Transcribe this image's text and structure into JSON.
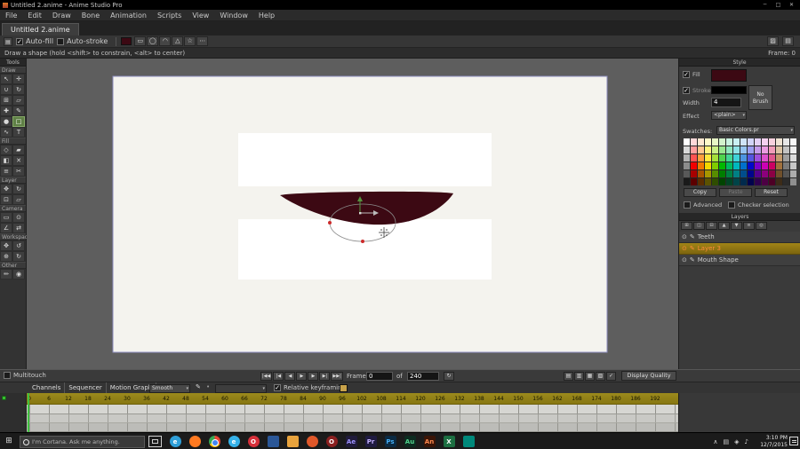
{
  "titlebar": {
    "title": "Untitled 2.anime - Anime Studio Pro",
    "window_buttons": [
      {
        "name": "minimize",
        "glyph": "─"
      },
      {
        "name": "maximize",
        "glyph": "□"
      },
      {
        "name": "close",
        "glyph": "✕"
      }
    ]
  },
  "menubar": {
    "items": [
      "File",
      "Edit",
      "Draw",
      "Bone",
      "Animation",
      "Scripts",
      "View",
      "Window",
      "Help"
    ]
  },
  "tabbar": {
    "active_tab": "Untitled 2.anime"
  },
  "toolbar": {
    "auto_fill_label": "Auto-fill",
    "auto_fill_checked": true,
    "auto_stroke_label": "Auto-stroke",
    "auto_stroke_checked": false,
    "shape_options": [
      {
        "name": "rectangle-option",
        "glyph": "▭"
      },
      {
        "name": "oval-option",
        "glyph": "◯"
      },
      {
        "name": "arc-option",
        "glyph": "◠"
      },
      {
        "name": "triangle-option",
        "glyph": "△"
      },
      {
        "name": "star-option",
        "glyph": "☆"
      },
      {
        "name": "more-options",
        "glyph": "⋯"
      }
    ],
    "right_buttons": [
      {
        "name": "panel-toggle-1",
        "glyph": "▨"
      },
      {
        "name": "panel-toggle-2",
        "glyph": "▤"
      }
    ]
  },
  "hintbar": {
    "hint": "Draw a shape (hold <shift> to constrain, <alt> to center)",
    "frame_indicator": "Frame: 0"
  },
  "tools_panel": {
    "title": "Tools",
    "selected_tool": "draw-shape",
    "sections": [
      {
        "label": "Draw",
        "tools": [
          "select",
          "translate-points",
          "magnet",
          "rotate-points",
          "scale-points",
          "shear",
          "add-point",
          "freehand",
          "blob",
          "draw-shape",
          "curvature",
          "text"
        ]
      },
      {
        "label": "Fill",
        "tools": [
          "select-shape",
          "create-shape",
          "paint-bucket",
          "delete-shape",
          "line-width",
          "hide-edge"
        ]
      },
      {
        "label": "Layer",
        "tools": [
          "translate-layer",
          "rotate-layer",
          "scale-layer",
          "shear-layer"
        ]
      },
      {
        "label": "Camera",
        "tools": [
          "track-camera",
          "zoom-camera",
          "roll-camera",
          "pan-tilt-camera"
        ]
      },
      {
        "label": "Workspace",
        "tools": [
          "pan",
          "orbit",
          "zoom",
          "rotate-workspace"
        ]
      },
      {
        "label": "Other",
        "tools": [
          "eyedropper",
          "noise"
        ]
      }
    ]
  },
  "canvas": {
    "backdrop": "#5e5e5e",
    "page_background": "#f4f3ee",
    "page_border": "#8d8dc0",
    "teeth_color": "#ffffff",
    "mouth_fill": "#3c0913",
    "selection_color": "#8a8a8a",
    "handle_color": "#cc2a2a",
    "arrow_up_color": "#55933f",
    "arrow_right_color": "#bbbbbb",
    "cursor_color": "#3a3a3a"
  },
  "style_panel": {
    "title": "Style",
    "fill_label": "Fill",
    "fill_checked": true,
    "fill_color": "#3c0913",
    "stroke_label": "Stroke",
    "stroke_checked": true,
    "stroke_color": "#000000",
    "width_label": "Width",
    "width_value": "4",
    "no_brush_label": "No Brush",
    "effect_label": "Effect",
    "effect_value": "<plain>",
    "swatches_label": "Swatches:",
    "swatches_value": "Basic Colors.pr",
    "copy_label": "Copy",
    "paste_label": "Paste",
    "reset_label": "Reset",
    "advanced_label": "Advanced",
    "advanced_checked": false,
    "checker_label": "Checker selection",
    "checker_checked": false,
    "palette": [
      [
        "#ffffff",
        "#ffd9d9",
        "#ffe8d1",
        "#fff9c9",
        "#e8f7c6",
        "#d2f2cb",
        "#c9f2e0",
        "#c9f0f2",
        "#cfe3f7",
        "#d1d4f7",
        "#e3d1f5",
        "#f5d1f0",
        "#f7d1de",
        "#efe3d3",
        "#e6e6e6",
        "#f7f7f7"
      ],
      [
        "#d9d9d9",
        "#ff9e9e",
        "#ffc78f",
        "#fff27d",
        "#c8ef84",
        "#98e68f",
        "#8fe6bc",
        "#8fe2e6",
        "#95c3f0",
        "#9b9ef0",
        "#c49bea",
        "#ea9be0",
        "#f09bb8",
        "#dbc3a3",
        "#c2c2c2",
        "#ededed"
      ],
      [
        "#b3b3b3",
        "#ff5252",
        "#ff9e3d",
        "#ffe83d",
        "#a4e03a",
        "#4fd44f",
        "#44d693",
        "#3fd2d8",
        "#4c95e0",
        "#5456e0",
        "#9c50dd",
        "#dd50cc",
        "#e0568d",
        "#c49a6c",
        "#9e9e9e",
        "#dbdbdb"
      ],
      [
        "#8c8c8c",
        "#f20000",
        "#f27a00",
        "#f2d800",
        "#7ecc00",
        "#00b800",
        "#00ba60",
        "#00b8be",
        "#0070cc",
        "#0008cc",
        "#7a00cc",
        "#cc00b4",
        "#cc0062",
        "#a1713d",
        "#7a7a7a",
        "#c7c7c7"
      ],
      [
        "#595959",
        "#a80000",
        "#a85400",
        "#a89600",
        "#578d00",
        "#007d00",
        "#008042",
        "#008084",
        "#004d8c",
        "#00058c",
        "#54008c",
        "#8c007c",
        "#8c0044",
        "#70502b",
        "#545454",
        "#adadad"
      ],
      [
        "#1a1a1a",
        "#5c0000",
        "#5c2e00",
        "#5c5200",
        "#2f4d00",
        "#004400",
        "#004424",
        "#004448",
        "#002a4d",
        "#00034d",
        "#2e004d",
        "#4d0044",
        "#4d0025",
        "#3d2c18",
        "#2b2b2b",
        "#8f8f8f"
      ]
    ]
  },
  "layers_panel": {
    "title": "Layers",
    "toolbar_buttons": [
      {
        "name": "new-layer",
        "glyph": "⊞"
      },
      {
        "name": "duplicate-layer",
        "glyph": "◫"
      },
      {
        "name": "delete-layer",
        "glyph": "⊟"
      },
      {
        "name": "move-layer-up",
        "glyph": "▲"
      },
      {
        "name": "move-layer-down",
        "glyph": "▼"
      },
      {
        "name": "layer-settings",
        "glyph": "≡"
      },
      {
        "name": "layer-search",
        "glyph": "◎"
      }
    ],
    "layers": [
      {
        "name": "Teeth",
        "selected": false
      },
      {
        "name": "Layer 3",
        "selected": true
      },
      {
        "name": "Mouth Shape",
        "selected": false
      }
    ]
  },
  "timeline": {
    "multitouch_label": "Multitouch",
    "multitouch_checked": false,
    "playback_buttons": [
      {
        "name": "go-to-start",
        "glyph": "|◀◀"
      },
      {
        "name": "previous-frame",
        "glyph": "|◀"
      },
      {
        "name": "step-back",
        "glyph": "◀"
      },
      {
        "name": "play",
        "glyph": "▶"
      },
      {
        "name": "step-forward",
        "glyph": "▶"
      },
      {
        "name": "next-frame",
        "glyph": "▶|"
      },
      {
        "name": "go-to-end",
        "glyph": "▶▶|"
      }
    ],
    "frame_label": "Frame",
    "frame_value": "0",
    "of_label": "of",
    "end_frame_value": "240",
    "loop_glyph": "↻",
    "view_buttons": [
      {
        "name": "view-mode-1",
        "glyph": "▤"
      },
      {
        "name": "view-mode-2",
        "glyph": "▥"
      },
      {
        "name": "view-mode-3",
        "glyph": "▦"
      },
      {
        "name": "view-mode-4",
        "glyph": "▧"
      },
      {
        "name": "onion-skin-toggle",
        "glyph": "✓"
      }
    ],
    "display_quality_label": "Display Quality",
    "tabs": [
      "Channels",
      "Sequencer",
      "Motion Graph"
    ],
    "interp_value": "Smooth",
    "autokey_glyph": "✎",
    "dot_glyph": "•",
    "relative_keyframing_label": "Relative keyframing",
    "relative_keyframing_checked": true,
    "key_color": "#c8a24a",
    "ruler_frames": [
      0,
      6,
      12,
      18,
      24,
      30,
      36,
      42,
      48,
      54,
      60,
      66,
      72,
      78,
      84,
      90,
      96,
      102,
      108,
      114,
      120,
      126,
      132,
      138,
      144,
      150,
      156,
      162,
      168,
      174,
      180,
      186,
      192
    ]
  },
  "taskbar": {
    "start_glyph": "⊞",
    "search_placeholder": "I'm Cortana. Ask me anything.",
    "apps": [
      {
        "name": "edge",
        "shape": "circle",
        "color": "#2f9fd8",
        "label": "e"
      },
      {
        "name": "firefox",
        "shape": "circle",
        "color": "#ff7a21"
      },
      {
        "name": "chrome",
        "shape": "circle",
        "color": "#4285f4"
      },
      {
        "name": "internet-explorer",
        "shape": "circle",
        "color": "#35b1e8",
        "label": "e"
      },
      {
        "name": "opera",
        "shape": "circle",
        "color": "#d6303a",
        "label": "O"
      },
      {
        "name": "blue-app",
        "shape": "square",
        "color": "#2b5797"
      },
      {
        "name": "paint-app",
        "shape": "square",
        "color": "#e8a33d"
      },
      {
        "name": "firefox-nightly",
        "shape": "circle",
        "color": "#e0582a"
      },
      {
        "name": "opera-classic",
        "shape": "circle",
        "color": "#8a2020",
        "label": "O"
      },
      {
        "name": "after-effects",
        "shape": "square",
        "color": "#201b3a",
        "label": "Ae",
        "fg": "#9f94ff"
      },
      {
        "name": "premiere",
        "shape": "square",
        "color": "#1f1b40",
        "label": "Pr",
        "fg": "#c5b2ff"
      },
      {
        "name": "photoshop",
        "shape": "square",
        "color": "#0b2a42",
        "label": "Ps",
        "fg": "#45aef5"
      },
      {
        "name": "audition",
        "shape": "square",
        "color": "#0d2b20",
        "label": "Au",
        "fg": "#54d48e"
      },
      {
        "name": "animate",
        "shape": "square",
        "color": "#3a1507",
        "label": "An",
        "fg": "#ff8a50"
      },
      {
        "name": "excel",
        "shape": "square",
        "color": "#1d6f42",
        "label": "X"
      },
      {
        "name": "teal-app",
        "shape": "square",
        "color": "#00897b"
      }
    ],
    "tray_icons": [
      {
        "name": "hidden-icons-chevron",
        "glyph": "∧"
      },
      {
        "name": "tray-icon-1",
        "glyph": "▤"
      },
      {
        "name": "tray-icon-2",
        "glyph": "◈"
      },
      {
        "name": "tray-icon-3",
        "glyph": "♪"
      }
    ],
    "time": "3:10 PM",
    "date": "12/7/2015"
  }
}
